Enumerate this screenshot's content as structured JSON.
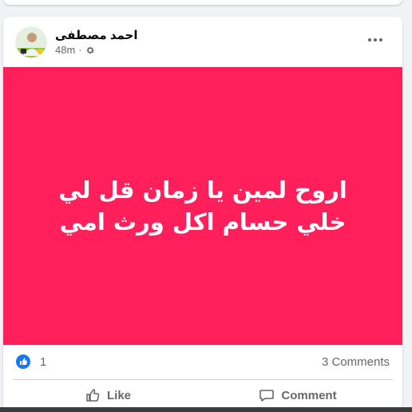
{
  "post": {
    "author": "احمد مصطفى",
    "time": "48m",
    "separator": "·",
    "privacy_icon": "gear-icon",
    "text": "اروح لمين يا زمان قل لي خلي حسام اكل ورث امي",
    "background_color": "#ff1f5a",
    "reactions_count": "1",
    "comments_label": "3 Comments"
  },
  "actions": {
    "like_label": "Like",
    "comment_label": "Comment"
  },
  "colors": {
    "accent_blue": "#1877f2",
    "muted_text": "#65676b"
  }
}
